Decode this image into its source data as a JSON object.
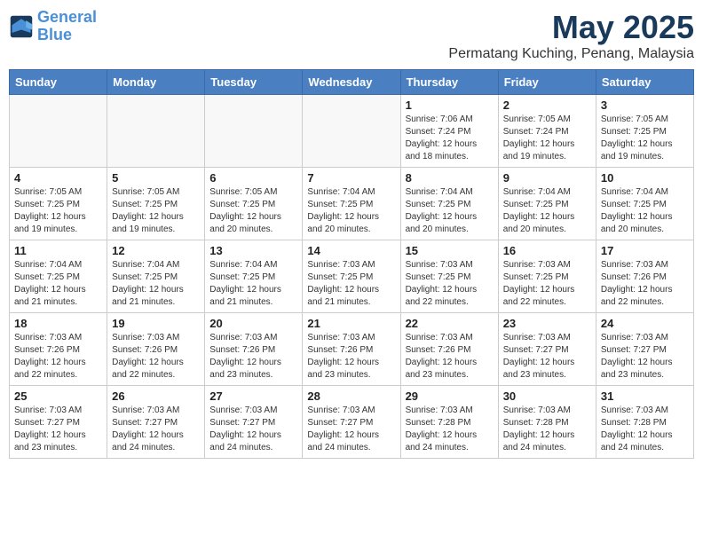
{
  "header": {
    "logo_line1": "General",
    "logo_line2": "Blue",
    "month": "May 2025",
    "location": "Permatang Kuching, Penang, Malaysia"
  },
  "weekdays": [
    "Sunday",
    "Monday",
    "Tuesday",
    "Wednesday",
    "Thursday",
    "Friday",
    "Saturday"
  ],
  "weeks": [
    [
      {
        "day": "",
        "info": ""
      },
      {
        "day": "",
        "info": ""
      },
      {
        "day": "",
        "info": ""
      },
      {
        "day": "",
        "info": ""
      },
      {
        "day": "1",
        "info": "Sunrise: 7:06 AM\nSunset: 7:24 PM\nDaylight: 12 hours\nand 18 minutes."
      },
      {
        "day": "2",
        "info": "Sunrise: 7:05 AM\nSunset: 7:24 PM\nDaylight: 12 hours\nand 19 minutes."
      },
      {
        "day": "3",
        "info": "Sunrise: 7:05 AM\nSunset: 7:25 PM\nDaylight: 12 hours\nand 19 minutes."
      }
    ],
    [
      {
        "day": "4",
        "info": "Sunrise: 7:05 AM\nSunset: 7:25 PM\nDaylight: 12 hours\nand 19 minutes."
      },
      {
        "day": "5",
        "info": "Sunrise: 7:05 AM\nSunset: 7:25 PM\nDaylight: 12 hours\nand 19 minutes."
      },
      {
        "day": "6",
        "info": "Sunrise: 7:05 AM\nSunset: 7:25 PM\nDaylight: 12 hours\nand 20 minutes."
      },
      {
        "day": "7",
        "info": "Sunrise: 7:04 AM\nSunset: 7:25 PM\nDaylight: 12 hours\nand 20 minutes."
      },
      {
        "day": "8",
        "info": "Sunrise: 7:04 AM\nSunset: 7:25 PM\nDaylight: 12 hours\nand 20 minutes."
      },
      {
        "day": "9",
        "info": "Sunrise: 7:04 AM\nSunset: 7:25 PM\nDaylight: 12 hours\nand 20 minutes."
      },
      {
        "day": "10",
        "info": "Sunrise: 7:04 AM\nSunset: 7:25 PM\nDaylight: 12 hours\nand 20 minutes."
      }
    ],
    [
      {
        "day": "11",
        "info": "Sunrise: 7:04 AM\nSunset: 7:25 PM\nDaylight: 12 hours\nand 21 minutes."
      },
      {
        "day": "12",
        "info": "Sunrise: 7:04 AM\nSunset: 7:25 PM\nDaylight: 12 hours\nand 21 minutes."
      },
      {
        "day": "13",
        "info": "Sunrise: 7:04 AM\nSunset: 7:25 PM\nDaylight: 12 hours\nand 21 minutes."
      },
      {
        "day": "14",
        "info": "Sunrise: 7:03 AM\nSunset: 7:25 PM\nDaylight: 12 hours\nand 21 minutes."
      },
      {
        "day": "15",
        "info": "Sunrise: 7:03 AM\nSunset: 7:25 PM\nDaylight: 12 hours\nand 22 minutes."
      },
      {
        "day": "16",
        "info": "Sunrise: 7:03 AM\nSunset: 7:25 PM\nDaylight: 12 hours\nand 22 minutes."
      },
      {
        "day": "17",
        "info": "Sunrise: 7:03 AM\nSunset: 7:26 PM\nDaylight: 12 hours\nand 22 minutes."
      }
    ],
    [
      {
        "day": "18",
        "info": "Sunrise: 7:03 AM\nSunset: 7:26 PM\nDaylight: 12 hours\nand 22 minutes."
      },
      {
        "day": "19",
        "info": "Sunrise: 7:03 AM\nSunset: 7:26 PM\nDaylight: 12 hours\nand 22 minutes."
      },
      {
        "day": "20",
        "info": "Sunrise: 7:03 AM\nSunset: 7:26 PM\nDaylight: 12 hours\nand 23 minutes."
      },
      {
        "day": "21",
        "info": "Sunrise: 7:03 AM\nSunset: 7:26 PM\nDaylight: 12 hours\nand 23 minutes."
      },
      {
        "day": "22",
        "info": "Sunrise: 7:03 AM\nSunset: 7:26 PM\nDaylight: 12 hours\nand 23 minutes."
      },
      {
        "day": "23",
        "info": "Sunrise: 7:03 AM\nSunset: 7:27 PM\nDaylight: 12 hours\nand 23 minutes."
      },
      {
        "day": "24",
        "info": "Sunrise: 7:03 AM\nSunset: 7:27 PM\nDaylight: 12 hours\nand 23 minutes."
      }
    ],
    [
      {
        "day": "25",
        "info": "Sunrise: 7:03 AM\nSunset: 7:27 PM\nDaylight: 12 hours\nand 23 minutes."
      },
      {
        "day": "26",
        "info": "Sunrise: 7:03 AM\nSunset: 7:27 PM\nDaylight: 12 hours\nand 24 minutes."
      },
      {
        "day": "27",
        "info": "Sunrise: 7:03 AM\nSunset: 7:27 PM\nDaylight: 12 hours\nand 24 minutes."
      },
      {
        "day": "28",
        "info": "Sunrise: 7:03 AM\nSunset: 7:27 PM\nDaylight: 12 hours\nand 24 minutes."
      },
      {
        "day": "29",
        "info": "Sunrise: 7:03 AM\nSunset: 7:28 PM\nDaylight: 12 hours\nand 24 minutes."
      },
      {
        "day": "30",
        "info": "Sunrise: 7:03 AM\nSunset: 7:28 PM\nDaylight: 12 hours\nand 24 minutes."
      },
      {
        "day": "31",
        "info": "Sunrise: 7:03 AM\nSunset: 7:28 PM\nDaylight: 12 hours\nand 24 minutes."
      }
    ]
  ]
}
